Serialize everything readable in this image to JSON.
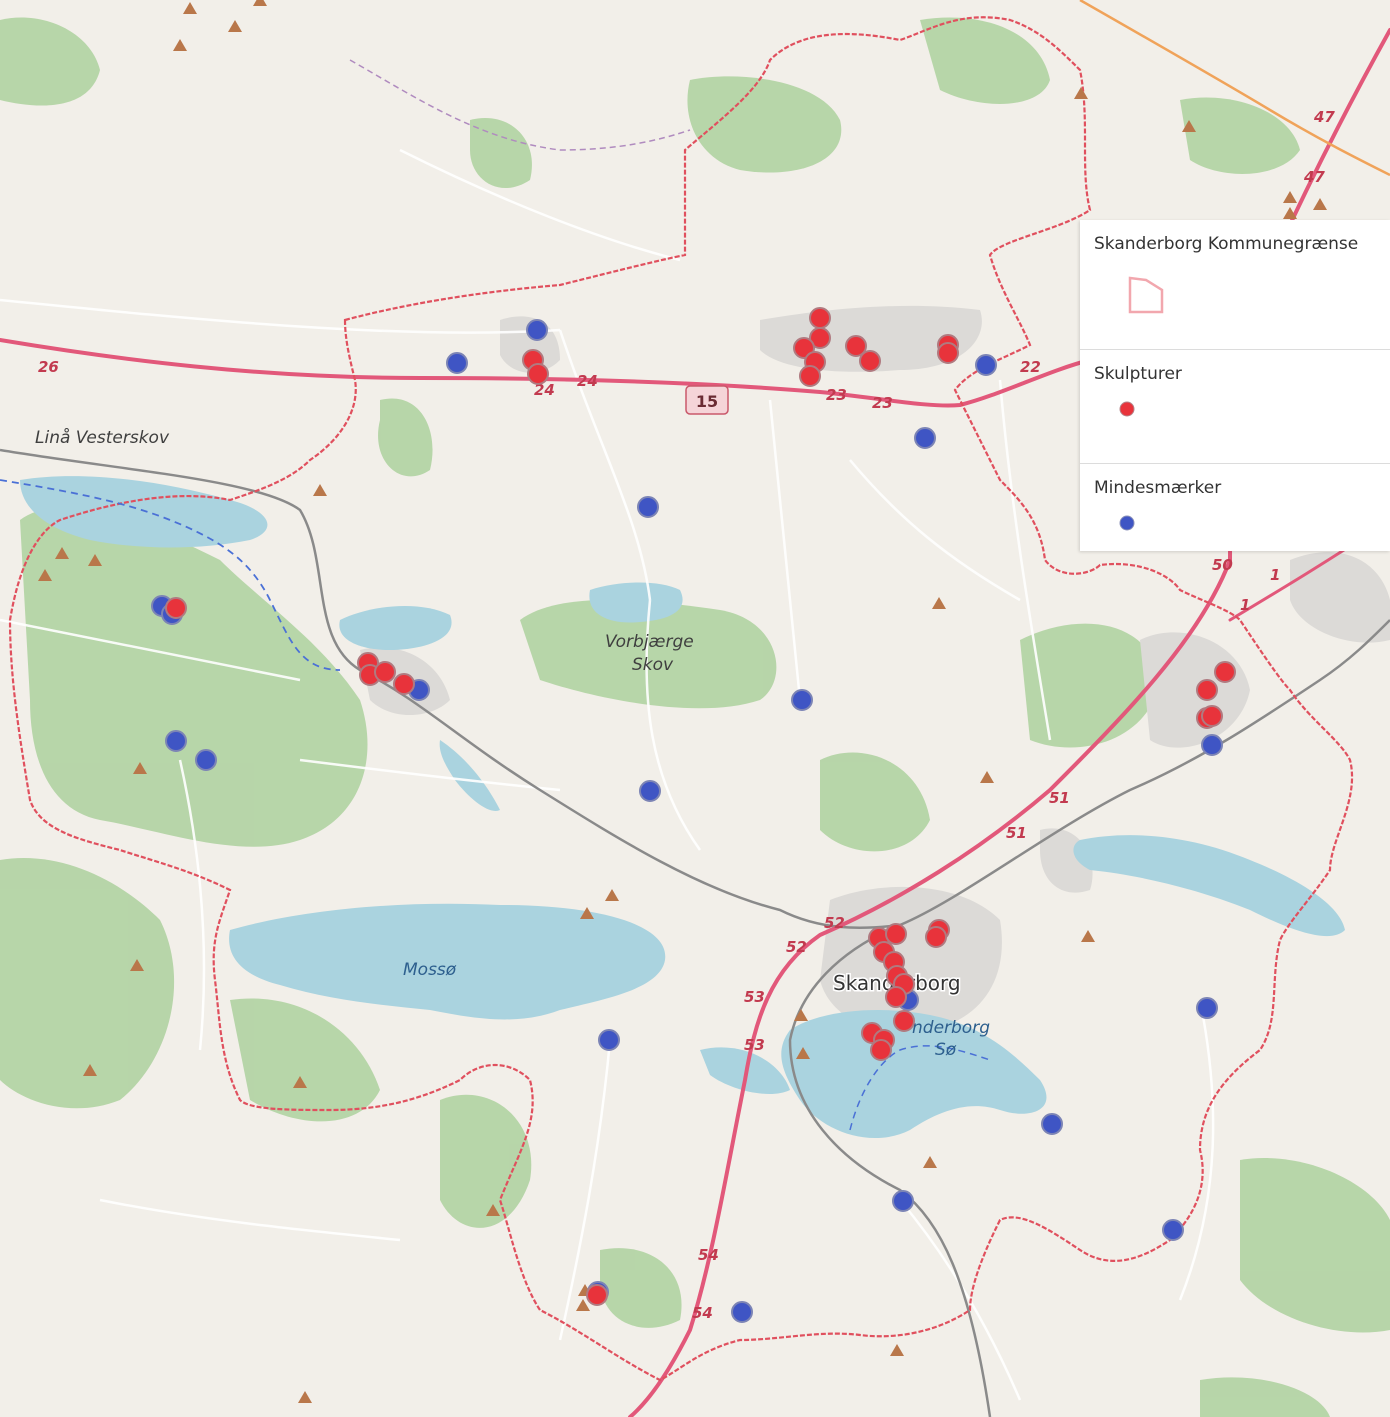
{
  "map": {
    "place_labels": {
      "vesterskov": "Linå Vesterskov",
      "vorbjaerge_1": "Vorbjærge",
      "vorbjaerge_2": "Skov",
      "town": "Skanderborg",
      "lake_mosso": "Mossø",
      "lake_skanderborg_1": "nderborg",
      "lake_skanderborg_2": "Sø"
    },
    "road_shield": "15",
    "road_labels": [
      "26",
      "24",
      "24",
      "23",
      "23",
      "22",
      "47",
      "47",
      "50",
      "1",
      "1",
      "51",
      "51",
      "52",
      "52",
      "53",
      "53",
      "54",
      "54"
    ]
  },
  "legend": {
    "items": [
      {
        "title": "Skanderborg Kommunegrænse",
        "symbol": "polygon-outline",
        "color": "#f2a7ae"
      },
      {
        "title": "Skulpturer",
        "symbol": "dot",
        "color": "#e8333b"
      },
      {
        "title": "Mindesmærker",
        "symbol": "dot",
        "color": "#3f55c4"
      }
    ]
  },
  "colors": {
    "background": "#f2efe9",
    "forest": "#add19e",
    "water": "#aad3df",
    "urban": "#dcdad7",
    "boundary": "#e0505e",
    "motorway": "#e2587a",
    "sculpture": "#e8333b",
    "memorial": "#3f55c4"
  }
}
